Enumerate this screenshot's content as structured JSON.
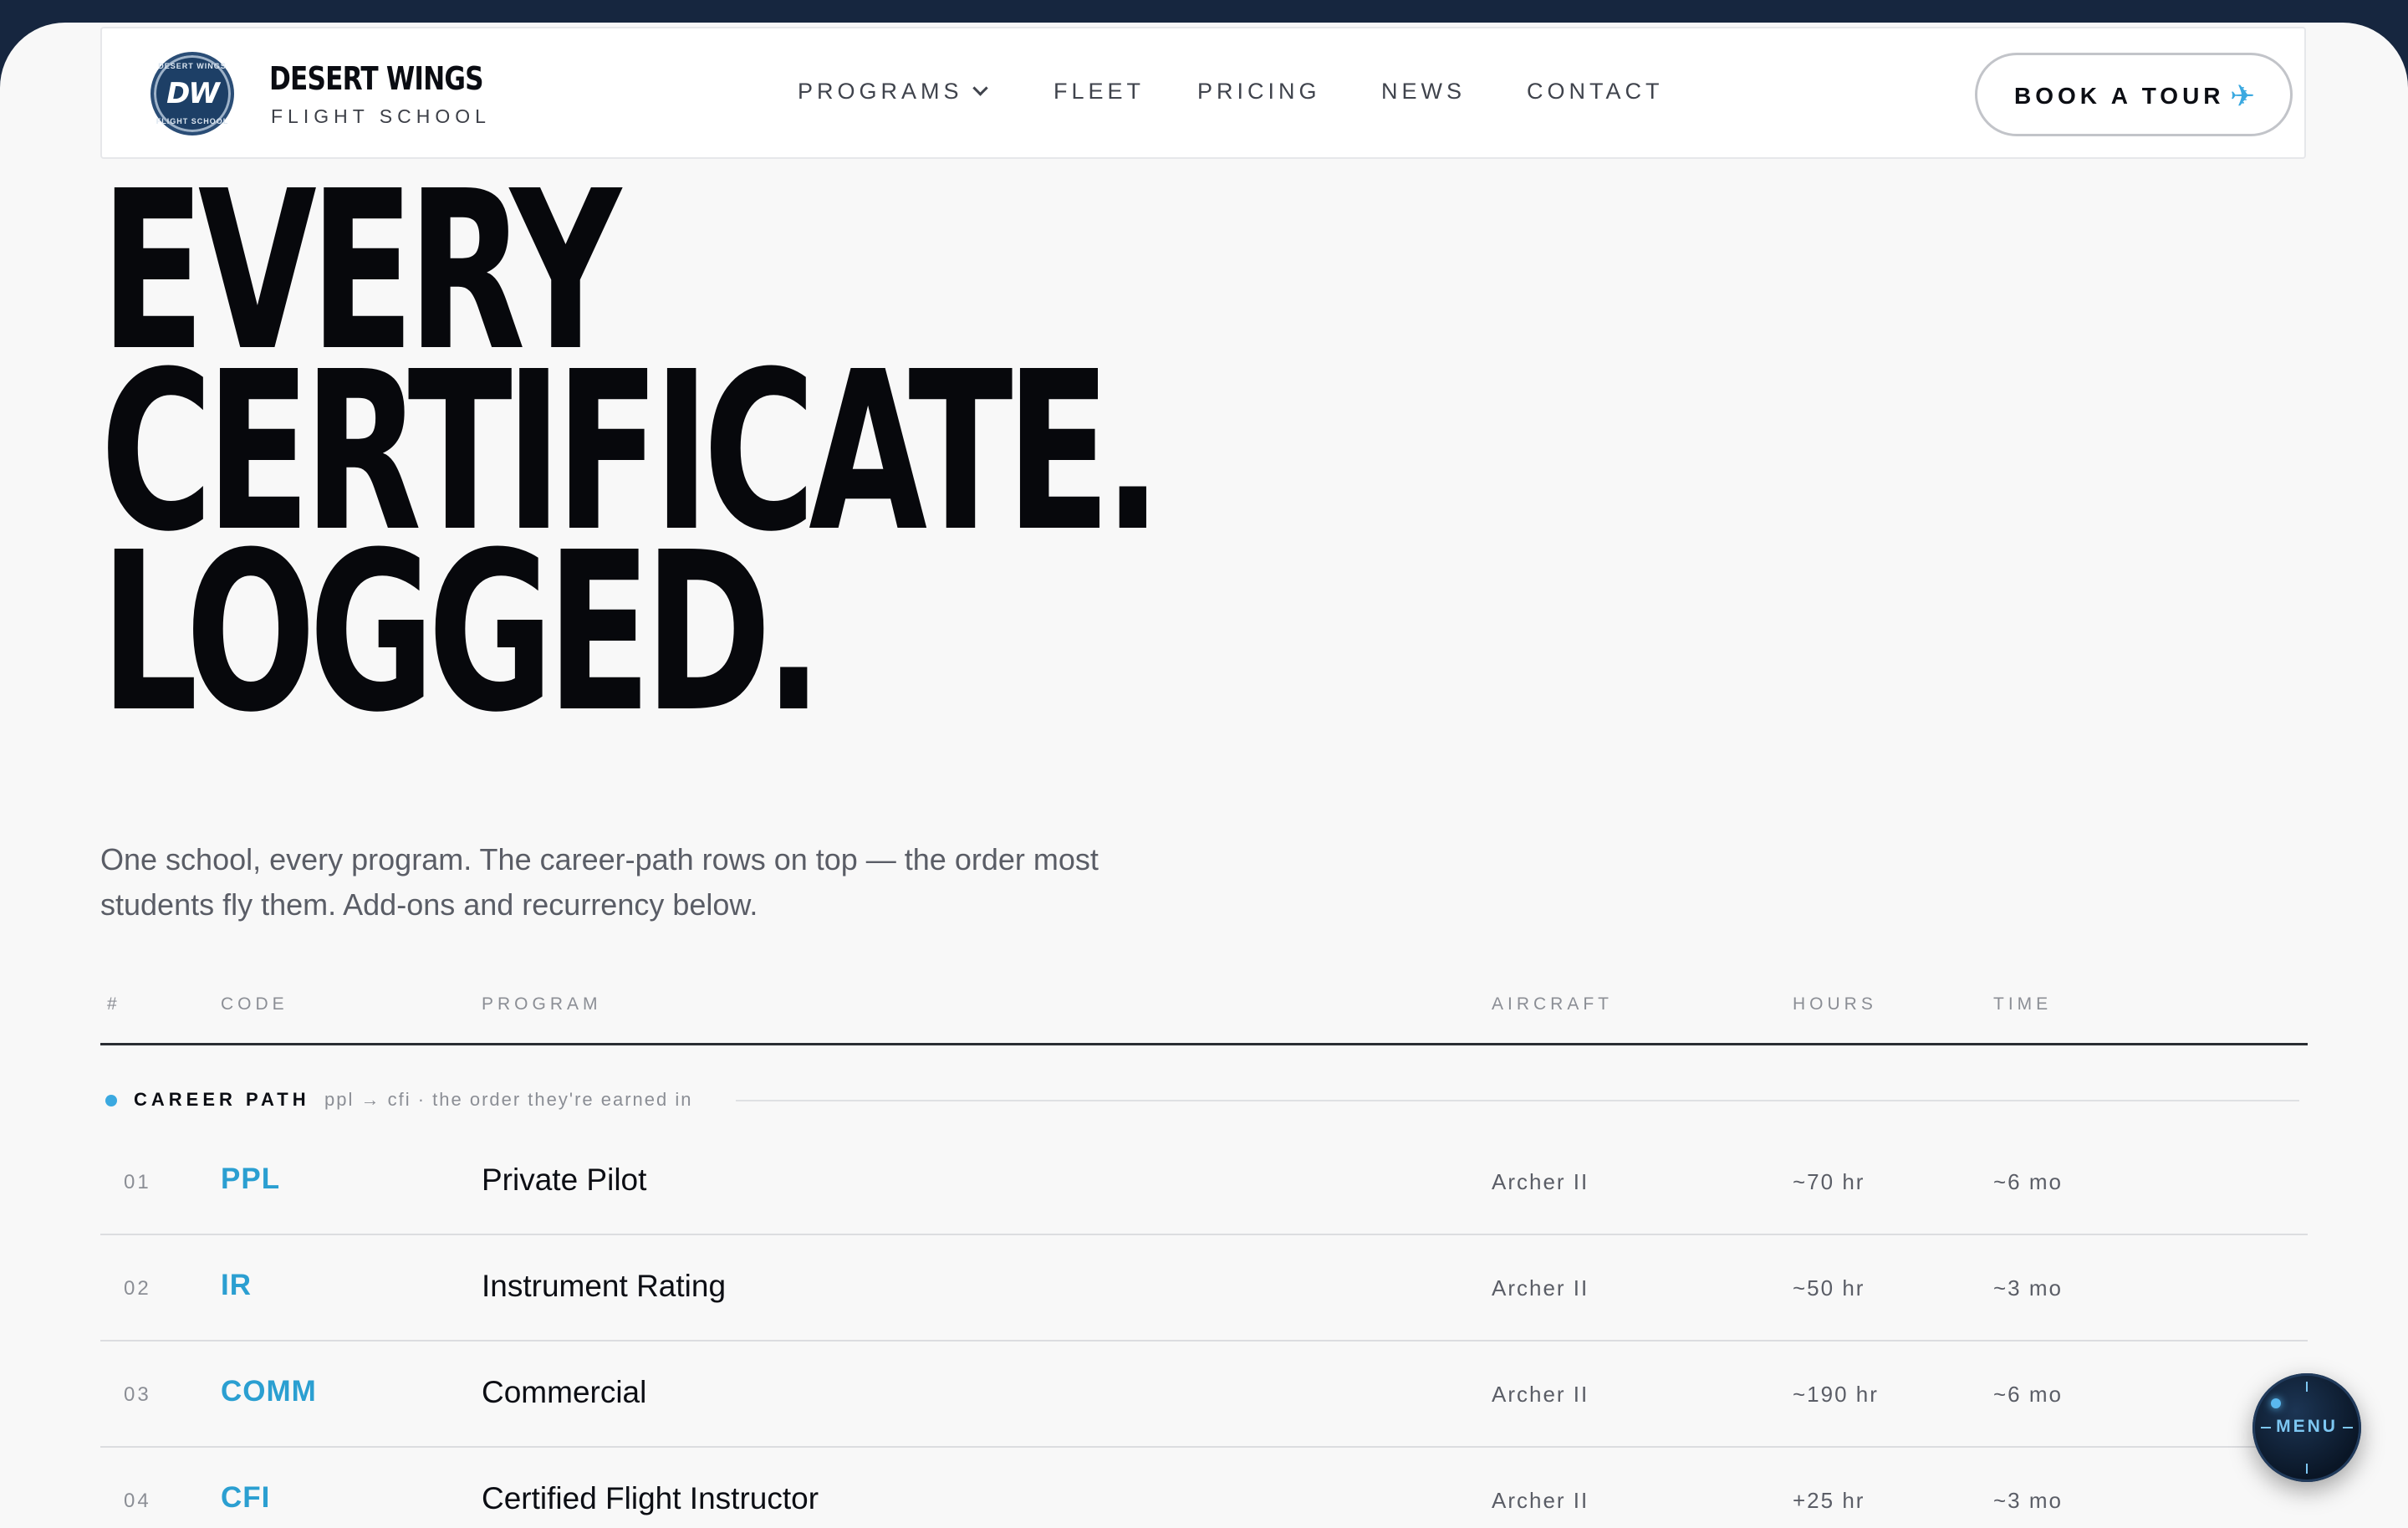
{
  "brand": {
    "name": "DESERT WINGS",
    "subtitle": "FLIGHT SCHOOL",
    "logo_monogram": "DW",
    "logo_ring_top": "DESERT WINGS",
    "logo_ring_bottom": "FLIGHT SCHOOL"
  },
  "nav": {
    "items": [
      {
        "label": "PROGRAMS",
        "dropdown": true
      },
      {
        "label": "FLEET"
      },
      {
        "label": "PRICING"
      },
      {
        "label": "NEWS"
      },
      {
        "label": "CONTACT"
      }
    ]
  },
  "cta": {
    "label": "BOOK A TOUR",
    "icon": "airplane-icon",
    "accent": "#3ba9e0"
  },
  "hero": {
    "lines": [
      "EVERY",
      "CERTIFICATE.",
      "LOGGED."
    ],
    "lede": "One school, every program. The career-path rows on top — the order most students fly them. Add-ons and recurrency below."
  },
  "table": {
    "headers": {
      "num": "#",
      "code": "CODE",
      "program": "PROGRAM",
      "aircraft": "AIRCRAFT",
      "hours": "HOURS",
      "time": "TIME"
    },
    "group": {
      "title": "CAREER PATH",
      "note": "ppl → cfi · the order they're earned in"
    },
    "rows": [
      {
        "num": "01",
        "code": "PPL",
        "program": "Private Pilot",
        "aircraft": "Archer II",
        "hours": "~70 hr",
        "time": "~6 mo"
      },
      {
        "num": "02",
        "code": "IR",
        "program": "Instrument Rating",
        "aircraft": "Archer II",
        "hours": "~50 hr",
        "time": "~3 mo"
      },
      {
        "num": "03",
        "code": "COMM",
        "program": "Commercial",
        "aircraft": "Archer II",
        "hours": "~190 hr",
        "time": "~6 mo"
      },
      {
        "num": "04",
        "code": "CFI",
        "program": "Certified Flight Instructor",
        "aircraft": "Archer II",
        "hours": "+25 hr",
        "time": "~3 mo"
      }
    ]
  },
  "menu_button": {
    "label": "MENU"
  }
}
